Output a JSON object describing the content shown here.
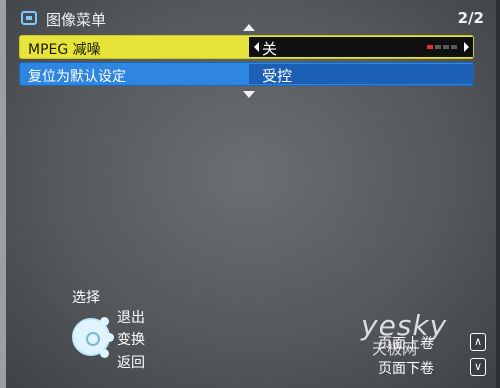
{
  "header": {
    "title": "图像菜单",
    "page": "2/2"
  },
  "menu": {
    "rows": [
      {
        "label": "MPEG 减噪",
        "value": "关",
        "selected": true,
        "level_active_segments": 1,
        "level_total_segments": 4
      },
      {
        "label": "复位为默认设定",
        "value": "受控",
        "selected": false
      }
    ]
  },
  "nav_help": {
    "select": "选择",
    "exit": "退出",
    "change": "变换",
    "back": "返回"
  },
  "page_help": {
    "page_up": "页面上卷",
    "page_down": "页面下卷",
    "up_symbol": "∧",
    "down_symbol": "∨"
  },
  "watermark": {
    "logo": "yesky",
    "text": "天极网"
  },
  "colors": {
    "selected_row": "#e6e43a",
    "normal_row": "#2f86e0",
    "level_on": "#e23131"
  }
}
